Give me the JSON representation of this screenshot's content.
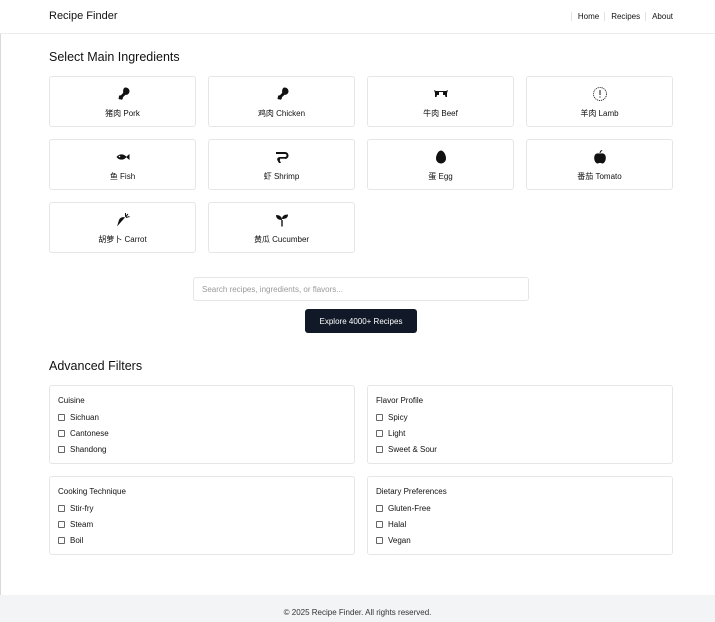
{
  "nav": {
    "brand": "Recipe Finder",
    "links": [
      "Home",
      "Recipes",
      "About"
    ]
  },
  "ingredients_section": {
    "title": "Select Main Ingredients",
    "items": [
      {
        "label": "猪肉 Pork",
        "icon": "drumstick-icon"
      },
      {
        "label": "鸡肉 Chicken",
        "icon": "drumstick-icon"
      },
      {
        "label": "牛肉 Beef",
        "icon": "cow-icon"
      },
      {
        "label": "羊肉 Lamb",
        "icon": "info-circle-icon"
      },
      {
        "label": "鱼 Fish",
        "icon": "fish-icon"
      },
      {
        "label": "虾 Shrimp",
        "icon": "shrimp-icon"
      },
      {
        "label": "蛋 Egg",
        "icon": "egg-icon"
      },
      {
        "label": "番茄 Tomato",
        "icon": "apple-icon"
      },
      {
        "label": "胡萝卜 Carrot",
        "icon": "carrot-icon"
      },
      {
        "label": "黄瓜 Cucumber",
        "icon": "seedling-icon"
      }
    ]
  },
  "search": {
    "placeholder": "Search recipes, ingredients, or flavors...",
    "value": ""
  },
  "explore_button": "Explore 4000+ Recipes",
  "advanced_filters": {
    "title": "Advanced Filters",
    "groups": [
      {
        "title": "Cuisine",
        "options": [
          "Sichuan",
          "Cantonese",
          "Shandong"
        ]
      },
      {
        "title": "Flavor Profile",
        "options": [
          "Spicy",
          "Light",
          "Sweet & Sour"
        ]
      },
      {
        "title": "Cooking Technique",
        "options": [
          "Stir-fry",
          "Steam",
          "Boil"
        ]
      },
      {
        "title": "Dietary Preferences",
        "options": [
          "Gluten-Free",
          "Halal",
          "Vegan"
        ]
      }
    ]
  },
  "footer": {
    "copyright": "© 2025 Recipe Finder. All rights reserved."
  },
  "colors": {
    "primary_button": "#111827",
    "footer_bg": "#f3f4f6",
    "border": "#e6e6e6"
  }
}
